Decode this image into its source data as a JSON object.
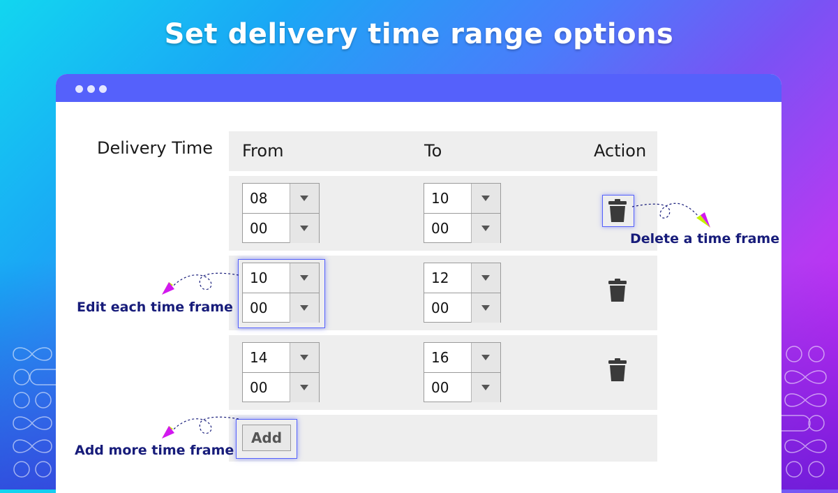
{
  "headline": "Set delivery time range options",
  "form": {
    "field_label": "Delivery Time",
    "columns": {
      "from": "From",
      "to": "To",
      "action": "Action"
    },
    "rows": [
      {
        "from": {
          "hour": "08",
          "minute": "00"
        },
        "to": {
          "hour": "10",
          "minute": "00"
        }
      },
      {
        "from": {
          "hour": "10",
          "minute": "00"
        },
        "to": {
          "hour": "12",
          "minute": "00"
        }
      },
      {
        "from": {
          "hour": "14",
          "minute": "00"
        },
        "to": {
          "hour": "16",
          "minute": "00"
        }
      }
    ],
    "add_label": "Add"
  },
  "callouts": {
    "delete": "Delete a time frame",
    "edit": "Edit each time frame",
    "add": "Add more time frame"
  },
  "icons": {
    "window_dots": "window-dots-icon",
    "dropdown": "chevron-down-icon",
    "delete": "trash-icon"
  },
  "colors": {
    "accent": "#5561fb",
    "callout_text": "#171c7a",
    "row_bg": "#eeeeee",
    "trash": "#3a3a3a"
  }
}
